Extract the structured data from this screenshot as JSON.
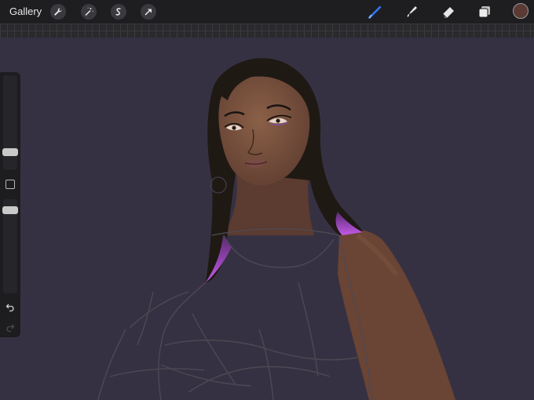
{
  "topbar": {
    "gallery_label": "Gallery",
    "left_tools": [
      {
        "name": "wrench-icon"
      },
      {
        "name": "magic-wand-icon"
      },
      {
        "name": "selection-icon"
      },
      {
        "name": "transform-arrow-icon"
      }
    ],
    "right_tools": [
      {
        "name": "brush-icon",
        "active": true,
        "color": "#2f7bff"
      },
      {
        "name": "smudge-icon"
      },
      {
        "name": "eraser-icon"
      },
      {
        "name": "layers-icon"
      }
    ],
    "current_color": "#5a3a32"
  },
  "sidebar": {
    "size_slider_level": 0.3,
    "opacity_slider_level": 0.95,
    "undo_icon": "undo-icon",
    "redo_icon": "redo-icon"
  },
  "canvas": {
    "background_color": "#363142",
    "skin_color": "#6e4a3c",
    "hair_color": "#1f1914",
    "hair_highlight_color": "#b14fd6"
  }
}
